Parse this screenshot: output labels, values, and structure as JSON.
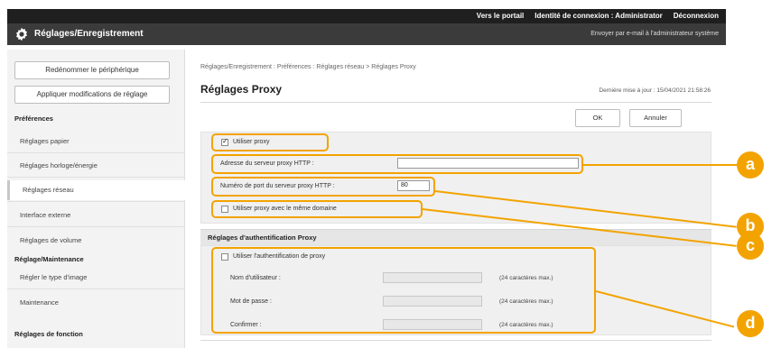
{
  "topbar": {
    "portal": "Vers le portail",
    "login_id": "Identité de connexion : Administrator",
    "logout": "Déconnexion"
  },
  "header": {
    "title": "Réglages/Enregistrement",
    "mail": "Envoyer par e-mail à l'administrateur système",
    "icon": "gear-icon"
  },
  "sidebar": {
    "rename_button": "Redénommer le périphérique",
    "apply_button": "Appliquer modifications de réglage",
    "cat_preferences": "Préférences",
    "items_pref": [
      "Réglages papier",
      "Réglages horloge/énergie",
      "Réglages réseau",
      "Interface externe",
      "Réglages de volume"
    ],
    "cat_maintenance": "Réglage/Maintenance",
    "items_maint": [
      "Régler le type d'image",
      "Maintenance"
    ],
    "cat_function": "Réglages de fonction"
  },
  "main": {
    "breadcrumb": "Réglages/Enregistrement : Préférences : Réglages réseau > Réglages Proxy",
    "title": "Réglages Proxy",
    "last_update": "Dernière mise à jour : 15/04/2021 21:58:26",
    "ok": "OK",
    "cancel": "Annuler",
    "use_proxy": "Utiliser proxy",
    "http_server_label": "Adresse du serveur proxy HTTP :",
    "http_server_value": "",
    "port_label": "Numéro de port du serveur proxy HTTP :",
    "port_value": "80",
    "same_domain": "Utiliser proxy avec le même domaine",
    "auth_section": "Réglages d'authentification Proxy",
    "use_auth": "Utiliser l'authentification de proxy",
    "username_label": "Nom d'utilisateur :",
    "password_label": "Mot de passe :",
    "confirm_label": "Confirmer :",
    "max_chars": "(24 caractères max.)"
  },
  "annotations": [
    "a",
    "b",
    "c",
    "d"
  ],
  "colors": {
    "accent": "#f3a300",
    "header": "#3b3b3b",
    "topbar": "#1f1f1f"
  }
}
